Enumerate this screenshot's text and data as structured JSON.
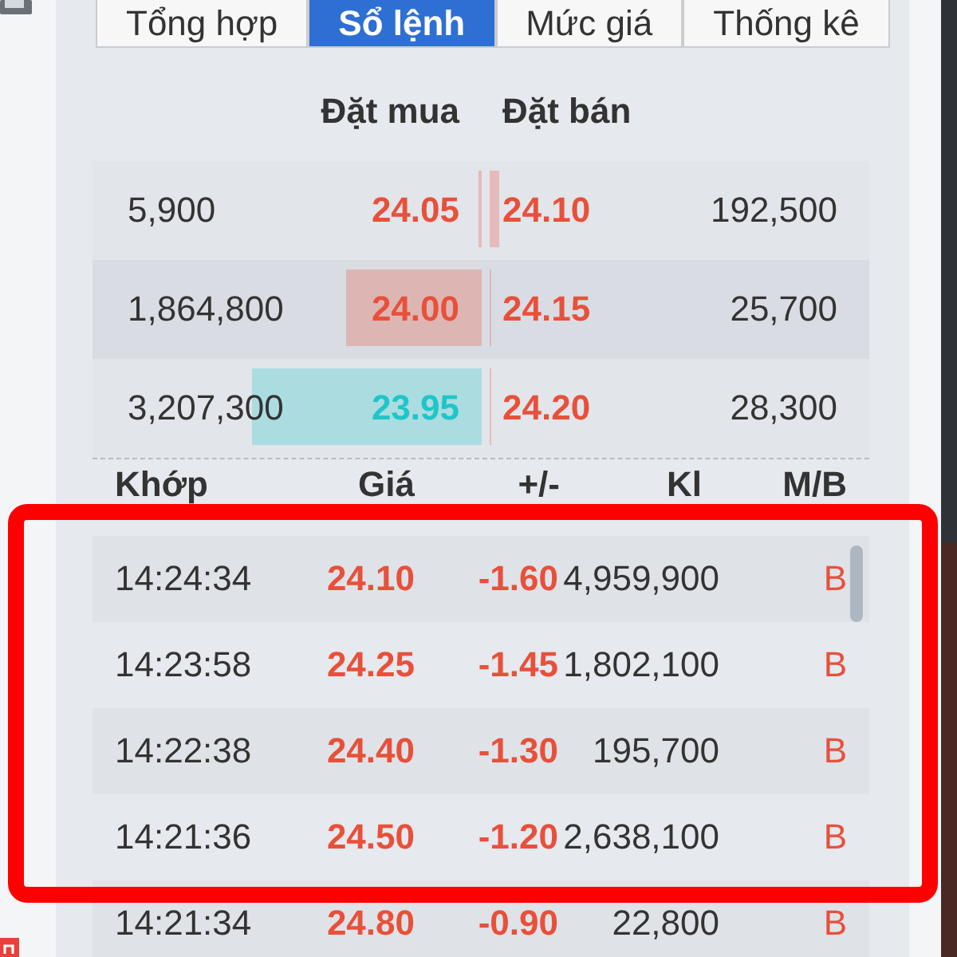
{
  "tabs": [
    {
      "label": "Tổng hợp",
      "selected": false
    },
    {
      "label": "Sổ lệnh",
      "selected": true
    },
    {
      "label": "Mức giá",
      "selected": false
    },
    {
      "label": "Thống kê",
      "selected": false
    }
  ],
  "order_book": {
    "columns": [
      "Đặt mua",
      "Đặt bán"
    ],
    "rows": [
      {
        "bid": {
          "volume": "5,900",
          "price": "24.05",
          "color": "#e8503a",
          "level": 0.008
        },
        "ask": {
          "price": "24.10",
          "color": "#e8503a",
          "level": 0.025,
          "volume": "192,500"
        }
      },
      {
        "bid": {
          "volume": "1,864,800",
          "price": "24.00",
          "color": "#e8503a",
          "level": 0.35
        },
        "ask": {
          "price": "24.15",
          "color": "#e8503a",
          "level": 0.006,
          "volume": "25,700"
        }
      },
      {
        "bid": {
          "volume": "3,207,300",
          "price": "23.95",
          "color": "#1ec6c8",
          "level": 0.59
        },
        "ask": {
          "price": "24.20",
          "color": "#e8503a",
          "level": 0.006,
          "volume": "28,300"
        }
      }
    ]
  },
  "trades": {
    "columns": [
      "Khớp",
      "Giá",
      "+/-",
      "Kl",
      "M/B"
    ],
    "rows": [
      {
        "time": "14:24:34",
        "price": "24.10",
        "change": "-1.60",
        "volume": "4,959,900",
        "side": "B"
      },
      {
        "time": "14:23:58",
        "price": "24.25",
        "change": "-1.45",
        "volume": "1,802,100",
        "side": "B"
      },
      {
        "time": "14:22:38",
        "price": "24.40",
        "change": "-1.30",
        "volume": "195,700",
        "side": "B"
      },
      {
        "time": "14:21:36",
        "price": "24.50",
        "change": "-1.20",
        "volume": "2,638,100",
        "side": "B"
      },
      {
        "time": "14:21:34",
        "price": "24.80",
        "change": "-0.90",
        "volume": "22,800",
        "side": "B"
      }
    ]
  }
}
